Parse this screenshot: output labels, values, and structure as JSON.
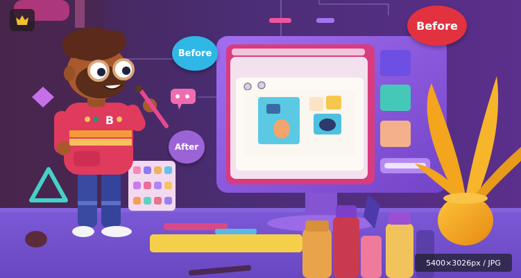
{
  "badge": {
    "icon": "crown-icon"
  },
  "bubbles": {
    "before_left": "Before",
    "before_right": "Before",
    "after": "After"
  },
  "shirt_text": "B",
  "image_info": "5400×3026px / JPG",
  "colors": {
    "background": "#3b2466",
    "monitor": "#8b56d9",
    "accent_pink": "#e8408a",
    "accent_teal": "#49c7c0",
    "plant": "#f2a51e"
  }
}
